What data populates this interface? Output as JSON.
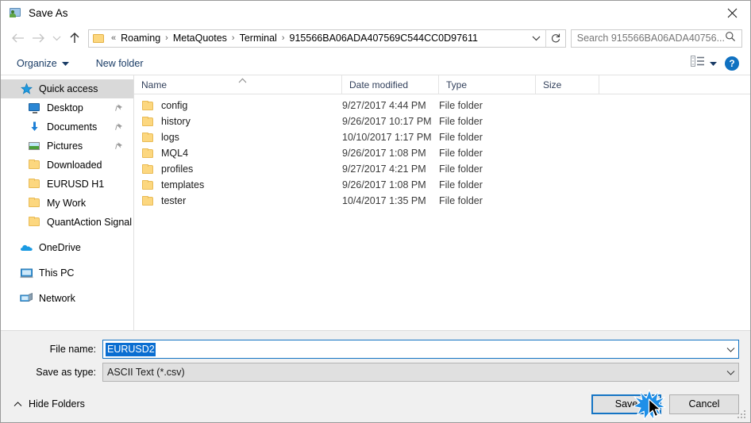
{
  "window": {
    "title": "Save As",
    "icon": "save-as-icon",
    "close_label": "✕"
  },
  "nav": {
    "back_icon": "arrow-left-icon",
    "forward_icon": "arrow-right-icon",
    "recent_icon": "chevron-down-icon",
    "up_icon": "arrow-up-icon",
    "refresh_icon": "refresh-icon",
    "address_prefix": "«",
    "breadcrumbs": [
      "Roaming",
      "MetaQuotes",
      "Terminal",
      "915566BA06ADA407569C544CC0D97611"
    ],
    "breadcrumb_separator": "›",
    "address_caret_icon": "chevron-down-icon"
  },
  "search": {
    "placeholder": "Search 915566BA06ADA40756...",
    "icon": "search-icon"
  },
  "toolbar": {
    "organize_label": "Organize",
    "organize_caret_icon": "caret-down-icon",
    "new_folder_label": "New folder",
    "view_icon": "view-options-icon",
    "view_caret_icon": "caret-down-icon",
    "help_label": "?",
    "help_icon": "help-icon"
  },
  "sidebar": {
    "items": [
      {
        "label": "Quick access",
        "icon": "star-icon",
        "selected": true,
        "indent": false,
        "pinned": false
      },
      {
        "label": "Desktop",
        "icon": "desktop-icon",
        "selected": false,
        "indent": true,
        "pinned": true
      },
      {
        "label": "Documents",
        "icon": "documents-download-icon",
        "selected": false,
        "indent": true,
        "pinned": true
      },
      {
        "label": "Pictures",
        "icon": "pictures-icon",
        "selected": false,
        "indent": true,
        "pinned": true
      },
      {
        "label": "Downloaded",
        "icon": "folder-icon",
        "selected": false,
        "indent": true,
        "pinned": false
      },
      {
        "label": "EURUSD H1",
        "icon": "folder-icon",
        "selected": false,
        "indent": true,
        "pinned": false
      },
      {
        "label": "My Work",
        "icon": "folder-icon",
        "selected": false,
        "indent": true,
        "pinned": false
      },
      {
        "label": "QuantAction Signal",
        "icon": "folder-icon",
        "selected": false,
        "indent": true,
        "pinned": false
      }
    ],
    "groups": [
      {
        "label": "OneDrive",
        "icon": "onedrive-cloud-icon"
      },
      {
        "label": "This PC",
        "icon": "this-pc-icon"
      },
      {
        "label": "Network",
        "icon": "network-icon"
      }
    ]
  },
  "filelist": {
    "columns": [
      "Name",
      "Date modified",
      "Type",
      "Size"
    ],
    "sort_column": "Name",
    "sort_icon": "sort-ascending-caret",
    "rows": [
      {
        "name": "config",
        "date": "9/27/2017 4:44 PM",
        "type": "File folder",
        "size": "",
        "icon": "folder-icon"
      },
      {
        "name": "history",
        "date": "9/26/2017 10:17 PM",
        "type": "File folder",
        "size": "",
        "icon": "folder-icon"
      },
      {
        "name": "logs",
        "date": "10/10/2017 1:17 PM",
        "type": "File folder",
        "size": "",
        "icon": "folder-icon"
      },
      {
        "name": "MQL4",
        "date": "9/26/2017 1:08 PM",
        "type": "File folder",
        "size": "",
        "icon": "folder-icon"
      },
      {
        "name": "profiles",
        "date": "9/27/2017 4:21 PM",
        "type": "File folder",
        "size": "",
        "icon": "folder-icon"
      },
      {
        "name": "templates",
        "date": "9/26/2017 1:08 PM",
        "type": "File folder",
        "size": "",
        "icon": "folder-icon"
      },
      {
        "name": "tester",
        "date": "10/4/2017 1:35 PM",
        "type": "File folder",
        "size": "",
        "icon": "folder-icon"
      }
    ]
  },
  "form": {
    "filename_label": "File name:",
    "filename_value": "EURUSD2",
    "filename_caret_icon": "chevron-down-icon",
    "filetype_label": "Save as type:",
    "filetype_value": "ASCII Text (*.csv)",
    "filetype_caret_icon": "chevron-down-icon"
  },
  "bottom": {
    "hide_folders_label": "Hide Folders",
    "hide_folders_icon": "chevron-up-icon",
    "save_label": "Save",
    "cancel_label": "Cancel",
    "resize_grip_icon": "resize-grip-icon",
    "click_effect_icon": "click-burst-icon",
    "cursor_icon": "mouse-pointer-icon"
  },
  "colors": {
    "accent": "#1474c4",
    "selection": "#0a6ed1",
    "folder": "#fcd77f",
    "help": "#1071c1",
    "burst": "#1e8fe8"
  }
}
